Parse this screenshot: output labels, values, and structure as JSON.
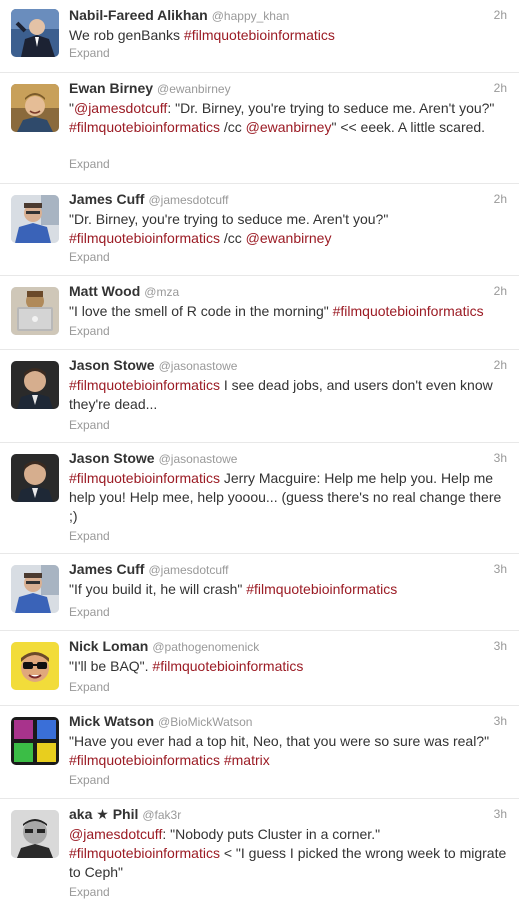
{
  "tweets": [
    {
      "name": "Nabil-Fareed Alikhan",
      "handle": "@happy_khan",
      "time": "2h",
      "expand": "Expand",
      "avatar": "avatar-man-suit-blue",
      "text": [
        {
          "t": "We rob genBanks ",
          "hl": false
        },
        {
          "t": "#filmquotebioinformatics",
          "hl": true
        }
      ]
    },
    {
      "name": "Ewan Birney",
      "handle": "@ewanbirney",
      "time": "2h",
      "expand": "Expand",
      "avatar": "avatar-man-smiling",
      "text": [
        {
          "t": "\"",
          "hl": false
        },
        {
          "t": "@jamesdotcuff",
          "hl": true
        },
        {
          "t": ": \"Dr. Birney, you're trying to seduce me. Aren't you?\" ",
          "hl": false
        },
        {
          "t": "#filmquotebioinformatics",
          "hl": true
        },
        {
          "t": " /cc ",
          "hl": false
        },
        {
          "t": "@ewanbirney",
          "hl": true
        },
        {
          "t": "\" << eeek. A little scared.",
          "hl": false
        }
      ]
    },
    {
      "name": "James Cuff",
      "handle": "@jamesdotcuff",
      "time": "2h",
      "expand": "Expand",
      "avatar": "avatar-man-blue-shirt",
      "text": [
        {
          "t": "\"Dr. Birney, you're trying to seduce me. Aren't you?\" ",
          "hl": false
        },
        {
          "t": "#filmquotebioinformatics",
          "hl": true
        },
        {
          "t": " /cc ",
          "hl": false
        },
        {
          "t": "@ewanbirney",
          "hl": true
        }
      ]
    },
    {
      "name": "Matt Wood",
      "handle": "@mza",
      "time": "2h",
      "expand": "Expand",
      "avatar": "avatar-laptop",
      "text": [
        {
          "t": "\"I love the smell of R code in the morning\" ",
          "hl": false
        },
        {
          "t": "#filmquotebioinformatics",
          "hl": true
        }
      ]
    },
    {
      "name": "Jason Stowe",
      "handle": "@jasonastowe",
      "time": "2h",
      "expand": "Expand",
      "avatar": "avatar-man-dark",
      "text": [
        {
          "t": "#filmquotebioinformatics",
          "hl": true
        },
        {
          "t": " I see dead jobs, and users don't even know they're dead...",
          "hl": false
        }
      ]
    },
    {
      "name": "Jason Stowe",
      "handle": "@jasonastowe",
      "time": "3h",
      "expand": "Expand",
      "avatar": "avatar-man-dark",
      "text": [
        {
          "t": "#filmquotebioinformatics",
          "hl": true
        },
        {
          "t": " Jerry Macguire: Help me help you. Help me help you! Help mee, help yooou... (guess there's no real change there ;)",
          "hl": false
        }
      ]
    },
    {
      "name": "James Cuff",
      "handle": "@jamesdotcuff",
      "time": "3h",
      "expand": "Expand",
      "avatar": "avatar-man-blue-shirt",
      "text": [
        {
          "t": "\"If you build it, he will crash\" ",
          "hl": false
        },
        {
          "t": "#filmquotebioinformatics",
          "hl": true
        }
      ]
    },
    {
      "name": "Nick Loman",
      "handle": "@pathogenomenick",
      "time": "3h",
      "expand": "Expand",
      "avatar": "avatar-sunglasses-yellow",
      "text": [
        {
          "t": "\"I'll be BAQ\". ",
          "hl": false
        },
        {
          "t": "#filmquotebioinformatics",
          "hl": true
        }
      ]
    },
    {
      "name": "Mick Watson",
      "handle": "@BioMickWatson",
      "time": "3h",
      "expand": "Expand",
      "avatar": "avatar-color-grid",
      "text": [
        {
          "t": "\"Have you ever had a top hit, Neo, that you were so sure was real?\" ",
          "hl": false
        },
        {
          "t": "#filmquotebioinformatics",
          "hl": true
        },
        {
          "t": " ",
          "hl": false
        },
        {
          "t": "#matrix",
          "hl": true
        }
      ]
    },
    {
      "name": "aka ★ Phil",
      "handle": "@fak3r",
      "time": "3h",
      "expand": "Expand",
      "avatar": "avatar-man-bw",
      "text": [
        {
          "t": "@jamesdotcuff",
          "hl": true
        },
        {
          "t": ": \"Nobody puts Cluster in a corner.\" ",
          "hl": false
        },
        {
          "t": "#filmquotebioinformatics",
          "hl": true
        },
        {
          "t": " < \"I guess I picked the wrong week to migrate to Ceph\"",
          "hl": false
        }
      ]
    }
  ],
  "colors": {
    "link": "#9b1b24",
    "meta": "#999999",
    "text": "#333333",
    "divider": "#e8e8e8"
  }
}
